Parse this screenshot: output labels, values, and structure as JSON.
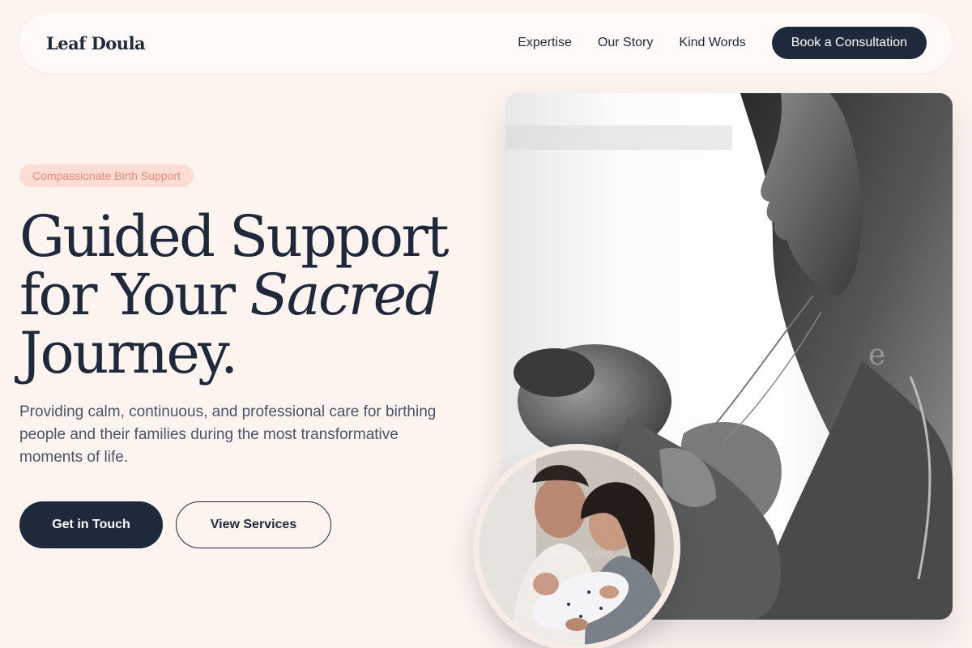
{
  "brand": {
    "name": "Leaf Doula"
  },
  "nav": {
    "links": [
      "Expertise",
      "Our Story",
      "Kind Words"
    ],
    "cta": "Book a Consultation"
  },
  "hero": {
    "badge": "Compassionate Birth Support",
    "headline": {
      "part1": "Guided Support",
      "part2": "for Your ",
      "emphasis": "Sacred",
      "part3": "Journey."
    },
    "lede": "Providing calm, continuous, and professional care for birthing people and their families during the most transformative moments of life.",
    "primary_cta": "Get in Touch",
    "secondary_cta": "View Services",
    "inset_caption": "Parenthood love"
  },
  "colors": {
    "background": "#fdf3ef",
    "navy": "#1e293b",
    "badge_bg": "#fcdcd3",
    "badge_text": "#e58b74"
  }
}
